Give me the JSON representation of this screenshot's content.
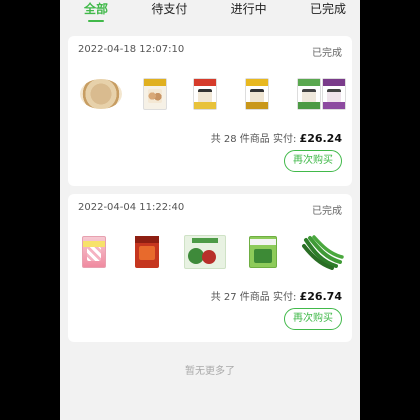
{
  "tabs": [
    {
      "label": "全部",
      "active": true
    },
    {
      "label": "待支付",
      "active": false
    },
    {
      "label": "进行中",
      "active": false
    },
    {
      "label": "已完成",
      "active": false
    }
  ],
  "orders": [
    {
      "date": "2022-04-18 12:07:10",
      "status": "已完成",
      "total_prefix": "共 28 件商品  实付:",
      "amount": "£26.24",
      "rebuy_label": "再次购买",
      "products": [
        "rice-plate",
        "fishballs-bag",
        "red-dumpling-bag",
        "yellow-dumpling-bag",
        "green-dumpling-bag",
        "purple-dumpling-bag"
      ]
    },
    {
      "date": "2022-04-04 11:22:40",
      "status": "已完成",
      "total_prefix": "共 27 件商品  实付:",
      "amount": "£26.74",
      "rebuy_label": "再次购买",
      "products": [
        "candy-bag",
        "chili-sauce-bag",
        "vegetable-box",
        "green-vegetable-bag",
        "green-chili-peppers"
      ]
    }
  ],
  "footer_text": "暂无更多了",
  "colors": {
    "accent": "#41b94a",
    "background": "#f2f2f2",
    "card": "#ffffff"
  }
}
